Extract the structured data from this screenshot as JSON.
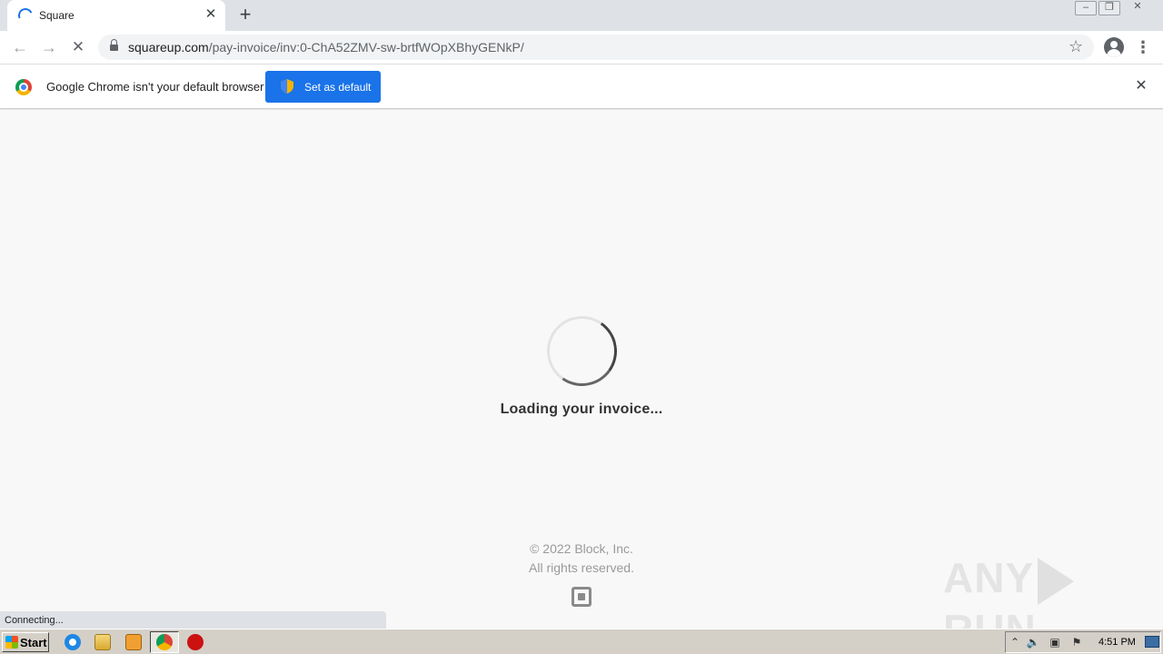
{
  "browser": {
    "tab": {
      "title": "Square"
    },
    "new_tab_symbol": "+",
    "address": {
      "host": "squareup.com",
      "path": "/pay-invoice/inv:0-ChA52ZMV-sw-brtfWOpXBhyGENkP/"
    },
    "infobar": {
      "message": "Google Chrome isn't your default browser",
      "button_label": "Set as default"
    },
    "status_text": "Connecting..."
  },
  "page": {
    "loading_text": "Loading your invoice...",
    "copyright_line1": "© 2022 Block, Inc.",
    "copyright_line2": "All rights reserved.",
    "watermark_left": "ANY",
    "watermark_right": "RUN"
  },
  "taskbar": {
    "start_label": "Start",
    "clock": "4:51 PM"
  },
  "colors": {
    "accent": "#1a73e8",
    "page_background": "#f8f8f8",
    "taskbar": "#d4d0c8"
  },
  "icons": [
    "loading-spinner-icon",
    "close-icon",
    "plus-icon",
    "back-icon",
    "forward-icon",
    "stop-icon",
    "lock-icon",
    "star-icon",
    "profile-icon",
    "menu-icon",
    "chrome-logo-icon",
    "shield-icon",
    "square-logo-icon"
  ]
}
